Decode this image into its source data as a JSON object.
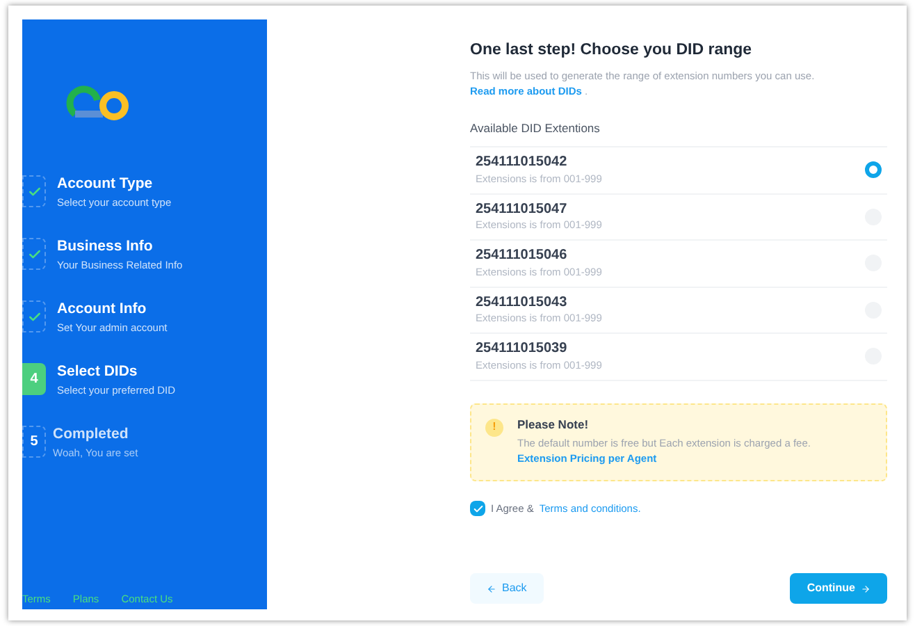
{
  "steps": [
    {
      "title": "Account Type",
      "subtitle": "Select your account type",
      "kind": "done"
    },
    {
      "title": "Business Info",
      "subtitle": "Your Business Related Info",
      "kind": "done"
    },
    {
      "title": "Account Info",
      "subtitle": "Set Your admin account",
      "kind": "done"
    },
    {
      "title": "Select DIDs",
      "subtitle": "Select your preferred DID",
      "kind": "current",
      "number": "4"
    },
    {
      "title": "Completed",
      "subtitle": "Woah, You are set",
      "kind": "pending",
      "number": "5"
    }
  ],
  "footer_links": [
    "Terms",
    "Plans",
    "Contact Us"
  ],
  "heading": "One last step! Choose you DID range",
  "intro": {
    "text": "This will be used to generate the range of extension numbers you can use.",
    "link": "Read more about DIDs",
    "after": "."
  },
  "list_title": "Available DID Extentions",
  "dids": [
    {
      "number": "254111015042",
      "range": "Extensions is from 001-999",
      "selected": true
    },
    {
      "number": "254111015047",
      "range": "Extensions is from 001-999",
      "selected": false
    },
    {
      "number": "254111015046",
      "range": "Extensions is from 001-999",
      "selected": false
    },
    {
      "number": "254111015043",
      "range": "Extensions is from 001-999",
      "selected": false
    },
    {
      "number": "254111015039",
      "range": "Extensions is from 001-999",
      "selected": false
    }
  ],
  "note": {
    "icon": "!",
    "title": "Please Note!",
    "text": "The default number is free but Each extension is charged a fee.",
    "link": "Extension Pricing per Agent"
  },
  "agree": {
    "checked": true,
    "text": "I Agree &",
    "link": "Terms and conditions."
  },
  "buttons": {
    "back": "Back",
    "continue": "Continue"
  }
}
